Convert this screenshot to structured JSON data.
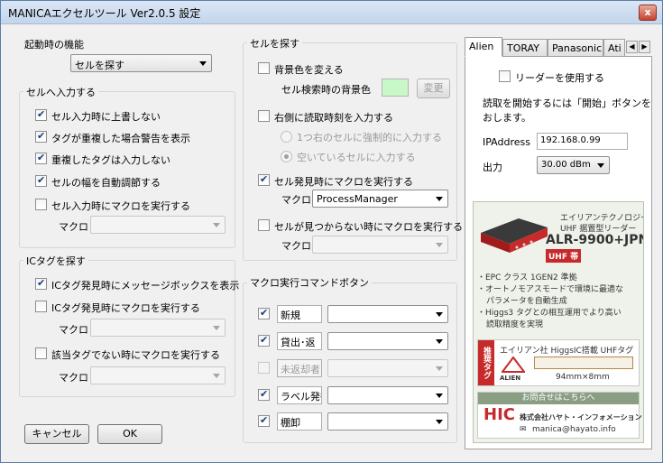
{
  "window": {
    "title": "MANICAエクセルツール Ver2.0.5  設定",
    "close_label": "x"
  },
  "startup": {
    "group_label": "起動時の機能",
    "selected": "セルを探す"
  },
  "cell_input": {
    "group_label": "セルへ入力する",
    "options": [
      {
        "label": "セル入力時に上書しない",
        "checked": true
      },
      {
        "label": "タグが重複した場合警告を表示",
        "checked": true
      },
      {
        "label": "重複したタグは入力しない",
        "checked": true
      },
      {
        "label": "セルの幅を自動調節する",
        "checked": true
      },
      {
        "label": "セル入力時にマクロを実行する",
        "checked": false
      }
    ],
    "macro_label": "マクロ",
    "macro_value": ""
  },
  "ic_tag": {
    "group_label": "ICタグを探す",
    "option1": "ICタグ発見時にメッセージボックスを表示",
    "option2": "ICタグ発見時にマクロを実行する",
    "macro1_label": "マクロ",
    "option3": "該当タグでない時にマクロを実行する",
    "macro2_label": "マクロ"
  },
  "cell_search": {
    "group_label": "セルを探す",
    "bg_change_label": "背景色を変える",
    "bg_color_label": "セル検索時の背景色",
    "bg_color": "#c8f7c8",
    "change_button": "変更",
    "time_right_label": "右側に読取時刻を入力する",
    "radio1": "1つ右のセルに強制的に入力する",
    "radio2": "空いているセルに入力する",
    "found_macro_label": "セル発見時にマクロを実行する",
    "macro_label": "マクロ",
    "macro_value": "ProcessManager",
    "notfound_macro_label": "セルが見つからない時にマクロを実行する",
    "macro2_label": "マクロ"
  },
  "macro_buttons": {
    "group_label": "マクロ実行コマンドボタン",
    "rows": [
      {
        "name": "新規",
        "checked": true,
        "enabled": true
      },
      {
        "name": "貸出･返",
        "checked": true,
        "enabled": true
      },
      {
        "name": "未返却者",
        "checked": false,
        "enabled": false
      },
      {
        "name": "ラベル発行",
        "checked": true,
        "enabled": true
      },
      {
        "name": "棚卸",
        "checked": true,
        "enabled": true
      }
    ]
  },
  "tabs": {
    "items": [
      "Alien",
      "TORAY",
      "Panasonic",
      "Ati"
    ],
    "active": "Alien",
    "use_reader": "リーダーを使用する",
    "instructions_line1": "読取を開始するには「開始」ボタンを",
    "instructions_line2": "おします。",
    "ip_label": "IPAddress",
    "ip_value": "192.168.0.99",
    "power_label": "出力",
    "power_value": "30.00 dBm"
  },
  "ad": {
    "maker_line": "エイリアンテクノロジー製",
    "reader_type": "UHF 据置型リーダー",
    "model": "ALR-9900+JPN",
    "band": "UHF 帯",
    "bullet1": "・EPC クラス 1GEN2 準拠",
    "bullet2a": "・オートノモアスモードで環境に最適な",
    "bullet2b": "パラメータを自動生成",
    "bullet3a": "・Higgs3 タグとの相互運用でより高い",
    "bullet3b": "読取精度を実現",
    "tag_badge": "推奨タグ",
    "tag_title": "エイリアン社 HiggsIC搭載 UHFタグ",
    "alien_logo": "ALIEN",
    "tag_size": "94mm×8mm",
    "contact_heading": "お問合せはこちらへ",
    "company_logo": "HIC",
    "company_name": "株式会社ハヤト・インフォメーション",
    "email": "manica@hayato.info"
  },
  "footer": {
    "cancel": "キャンセル",
    "ok": "OK"
  }
}
